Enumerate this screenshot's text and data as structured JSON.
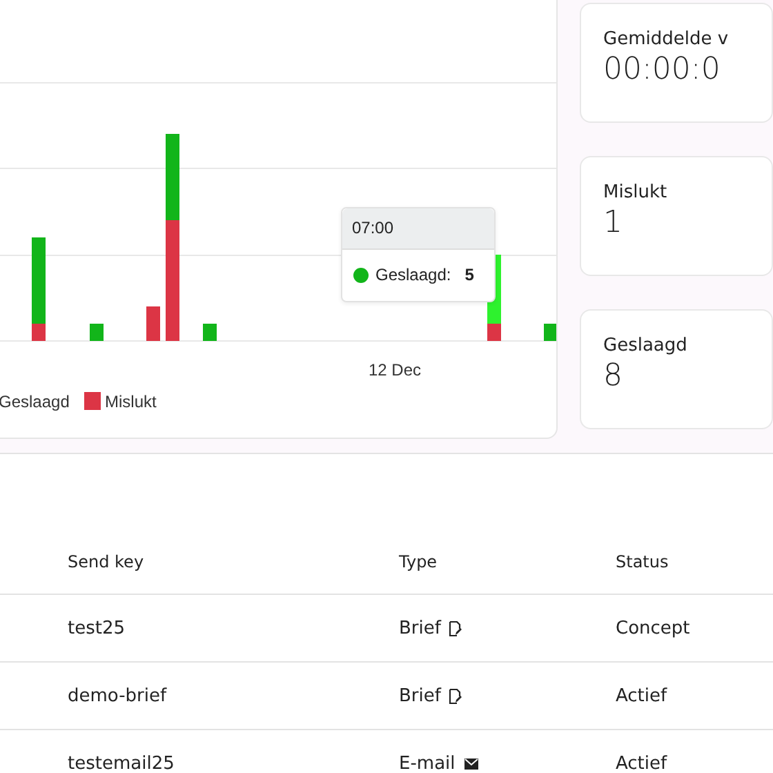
{
  "chart": {
    "x_label": "12 Dec",
    "legend": [
      {
        "label": "Geslaagd"
      },
      {
        "label": "Mislukt",
        "color": "#dc3545"
      }
    ],
    "tooltip": {
      "title": "07:00",
      "series": "Geslaagd:",
      "value": "5",
      "color": "#12b51a"
    }
  },
  "stats": [
    {
      "label": "Gemiddelde v",
      "value": "00:00:0"
    },
    {
      "label": "Mislukt",
      "value": "1"
    },
    {
      "label": "Geslaagd",
      "value": "8"
    }
  ],
  "table": {
    "columns": [
      "Send key",
      "Type",
      "Status"
    ],
    "rows": [
      {
        "send_key": "test25",
        "type": "Brief",
        "kind": "letter",
        "status": "Concept"
      },
      {
        "send_key": "demo-brief",
        "type": "Brief",
        "kind": "letter",
        "status": "Actief"
      },
      {
        "send_key": "testemail25",
        "type": "E-mail",
        "kind": "email",
        "status": "Actief"
      }
    ]
  }
}
